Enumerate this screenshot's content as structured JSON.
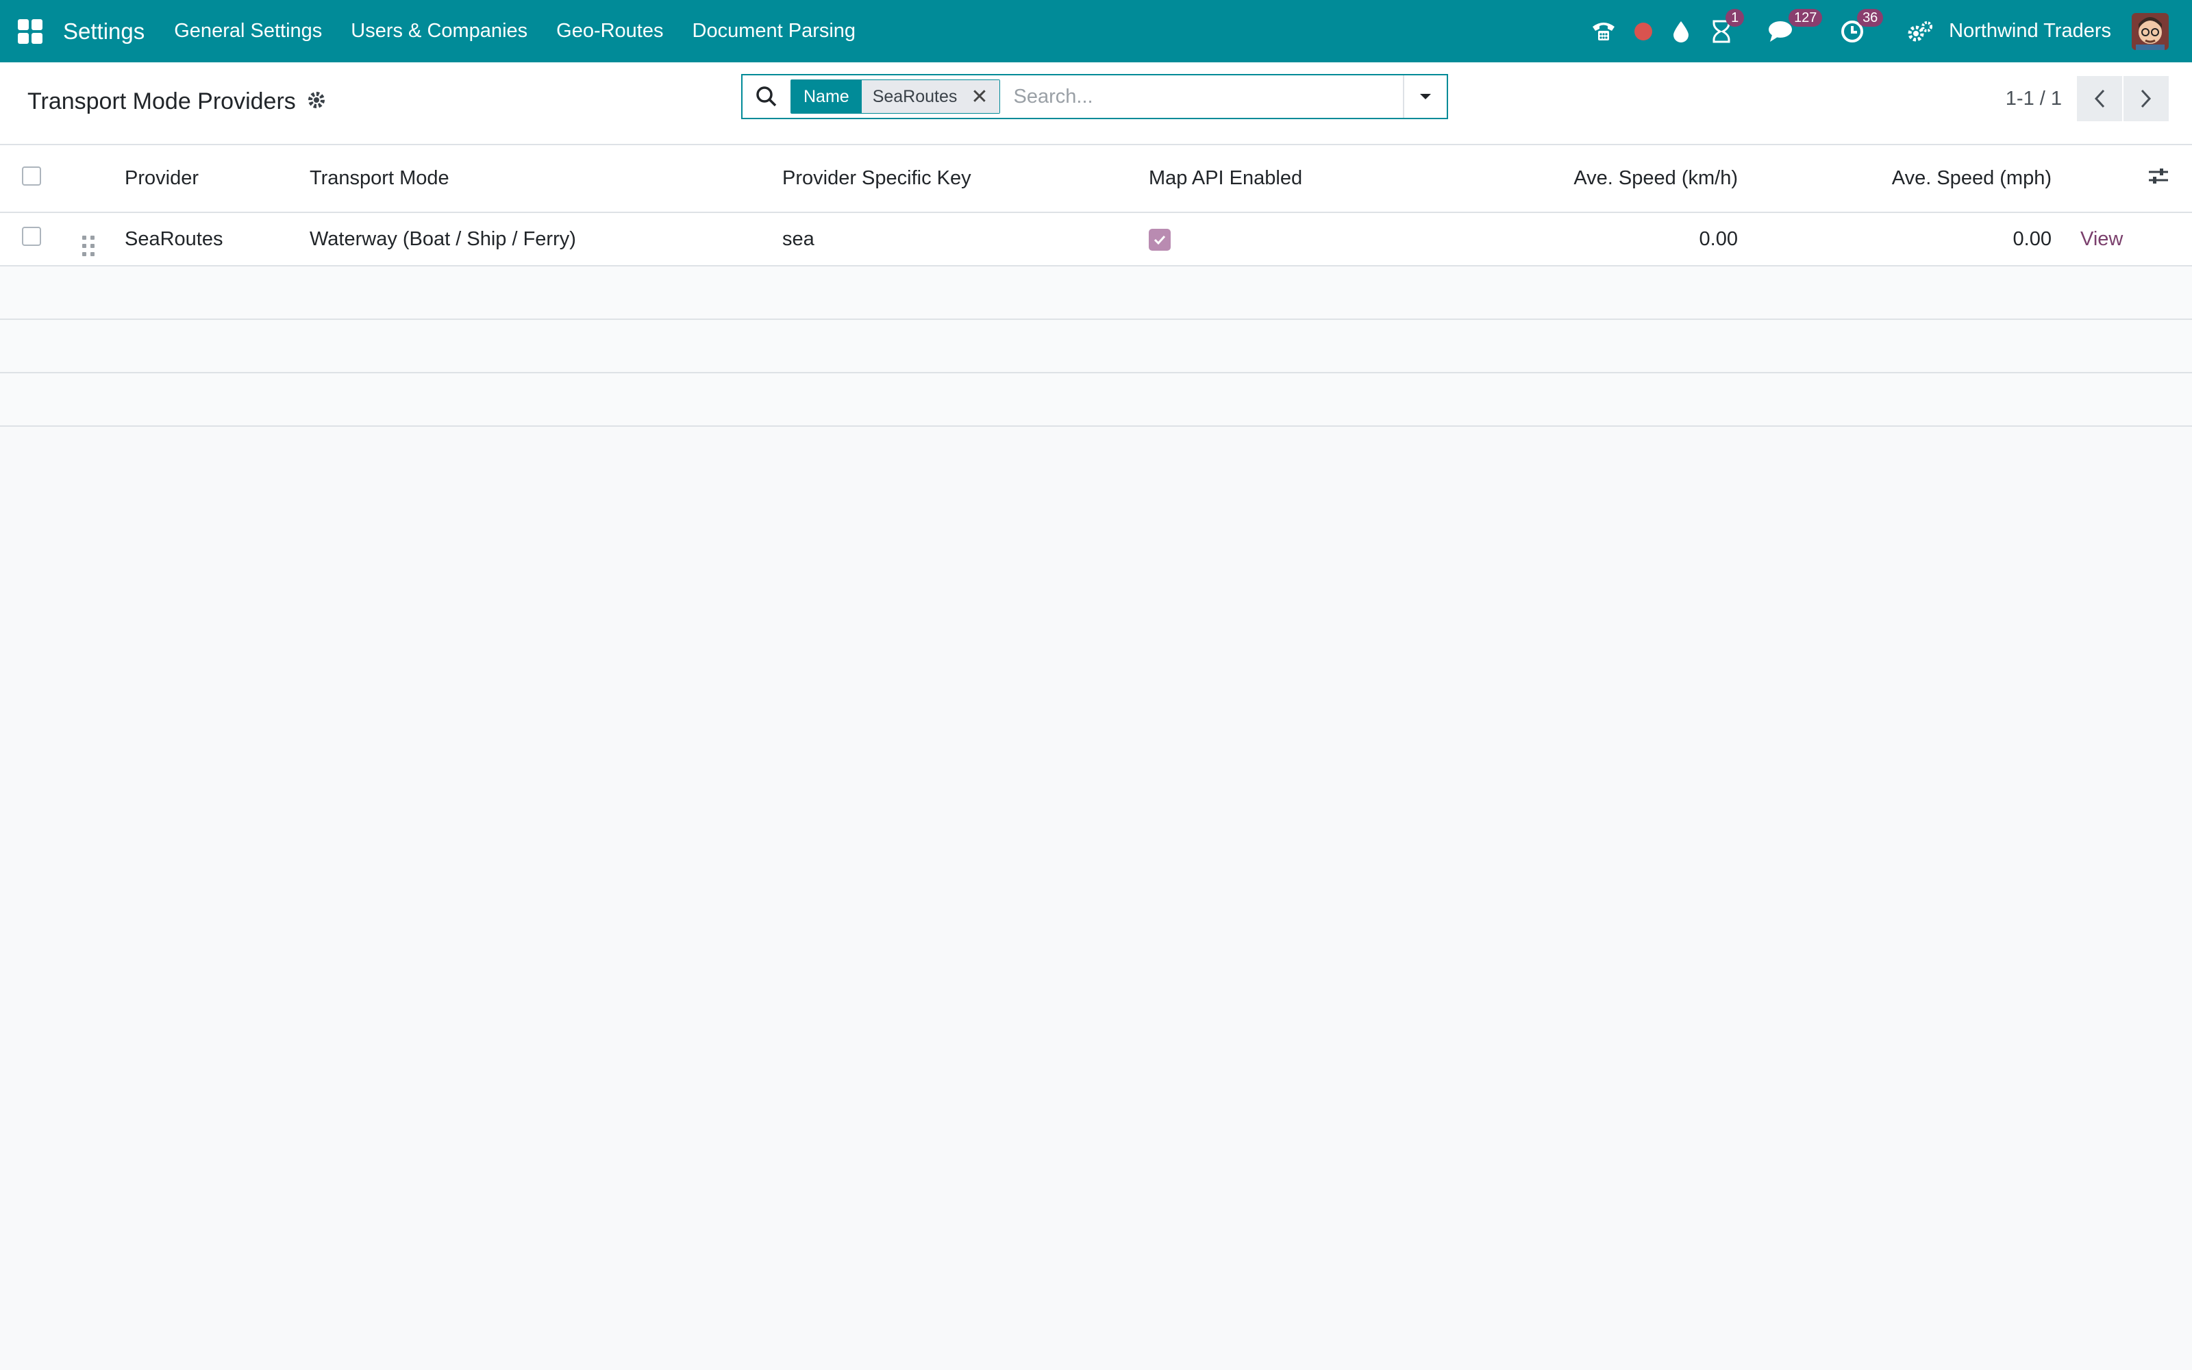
{
  "topbar": {
    "app_name": "Settings",
    "nav": [
      "General Settings",
      "Users & Companies",
      "Geo-Routes",
      "Document Parsing"
    ],
    "activity_badge": "1",
    "messages_badge": "127",
    "clock_badge": "36",
    "company": "Northwind Traders"
  },
  "control": {
    "title": "Transport Mode Providers",
    "search": {
      "facet_label": "Name",
      "facet_value": "SeaRoutes",
      "placeholder": "Search..."
    },
    "pager": "1-1 / 1"
  },
  "table": {
    "headers": {
      "provider": "Provider",
      "transport_mode": "Transport Mode",
      "key": "Provider Specific Key",
      "map_api": "Map API Enabled",
      "speed_kmh": "Ave. Speed (km/h)",
      "speed_mph": "Ave. Speed (mph)"
    },
    "rows": [
      {
        "provider": "SeaRoutes",
        "transport_mode": "Waterway (Boat / Ship / Ferry)",
        "key": "sea",
        "map_api_enabled": true,
        "speed_kmh": "0.00",
        "speed_mph": "0.00",
        "action": "View"
      }
    ]
  },
  "colors": {
    "brand": "#018b98",
    "badge": "#8a3e6e",
    "link": "#7a3f6c",
    "checkbox_checked": "#b98bb1"
  },
  "icons": [
    "apps-icon",
    "phone-icon",
    "record-icon",
    "drop-icon",
    "activity-icon",
    "messages-icon",
    "clock-icon",
    "settings-icon",
    "gear-icon",
    "search-icon",
    "caret-down-icon",
    "chevron-left-icon",
    "chevron-right-icon",
    "drag-handle-icon",
    "columns-settings-icon",
    "check-icon"
  ]
}
